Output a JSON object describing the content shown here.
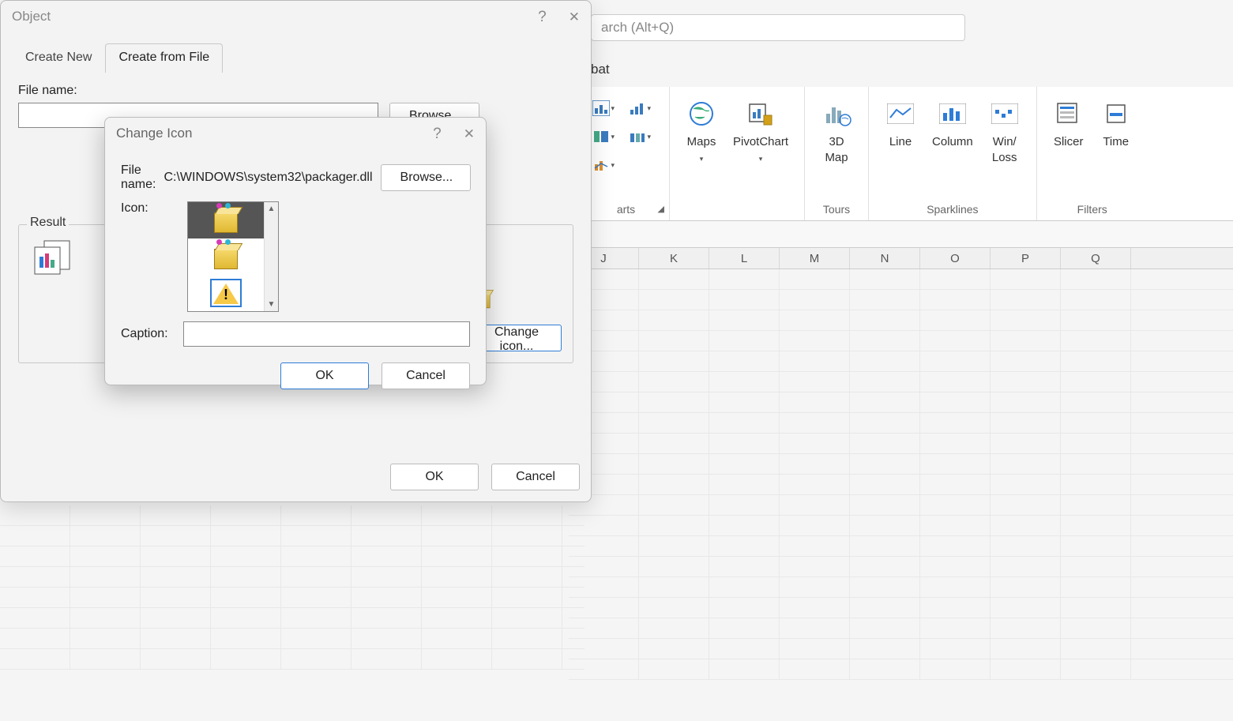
{
  "search": {
    "placeholder": "arch (Alt+Q)"
  },
  "ribbonTab": "bat",
  "ribbon": {
    "maps": "Maps",
    "pivotchart": "PivotChart",
    "threeDmap": "3D\nMap",
    "line": "Line",
    "column": "Column",
    "winloss": "Win/\nLoss",
    "slicer": "Slicer",
    "timeline": "Time",
    "groups": {
      "charts": "arts",
      "tours": "Tours",
      "sparklines": "Sparklines",
      "filters": "Filters"
    }
  },
  "columns": [
    "J",
    "K",
    "L",
    "M",
    "N",
    "O",
    "P",
    "Q"
  ],
  "objectDialog": {
    "title": "Object",
    "tabs": {
      "createNew": "Create New",
      "createFromFile": "Create from File"
    },
    "fileNameLabel": "File name:",
    "fileNameValue": "",
    "browse": "Browse...",
    "resultLegend": "Result",
    "changeIcon": "Change icon...",
    "ok": "OK",
    "cancel": "Cancel"
  },
  "changeIcon": {
    "title": "Change Icon",
    "fileNameLabel": "File name:",
    "path": "C:\\WINDOWS\\system32\\packager.dll",
    "browse": "Browse...",
    "iconLabel": "Icon:",
    "captionLabel": "Caption:",
    "captionValue": "",
    "ok": "OK",
    "cancel": "Cancel"
  }
}
